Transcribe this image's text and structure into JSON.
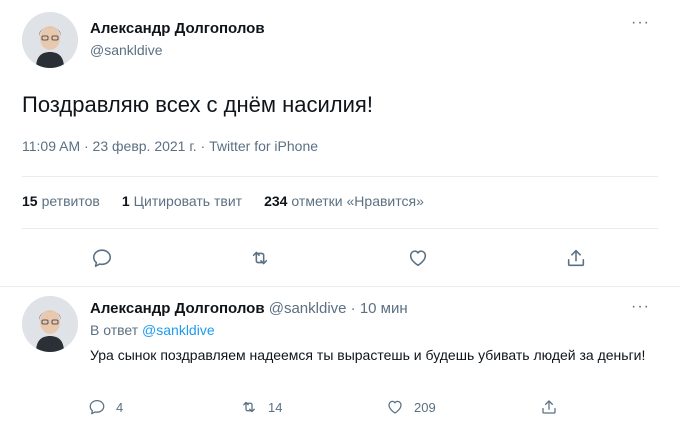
{
  "tweet": {
    "author_name": "Александр Долгополов",
    "author_handle": "@sankldive",
    "more": "···",
    "text": "Поздравляю всех с днём насилия!",
    "meta": "11:09 AM · 23 февр. 2021 г. · Twitter for iPhone",
    "stats": {
      "retweets_count": "15",
      "retweets_label": "ретвитов",
      "quotes_count": "1",
      "quotes_label": "Цитировать твит",
      "likes_count": "234",
      "likes_label": "отметки «Нравится»"
    },
    "actions": [
      "reply-icon",
      "retweet-icon",
      "like-icon",
      "share-icon"
    ]
  },
  "reply": {
    "author_name": "Александр Долгополов",
    "header_rest": "@sankldive · 10 мин",
    "more": "···",
    "reply_to_prefix": "В ответ",
    "reply_to_handle": "@sankldive",
    "text": "Ура сынок поздравляем надеемся ты вырастешь и будешь убивать людей за деньги!",
    "reply_count": "4",
    "retweet_count": "14",
    "like_count": "209"
  },
  "colors": {
    "text": "#0f1419",
    "secondary": "#5b7083",
    "link": "#1d9bf0",
    "divider": "#e6ecf0"
  }
}
